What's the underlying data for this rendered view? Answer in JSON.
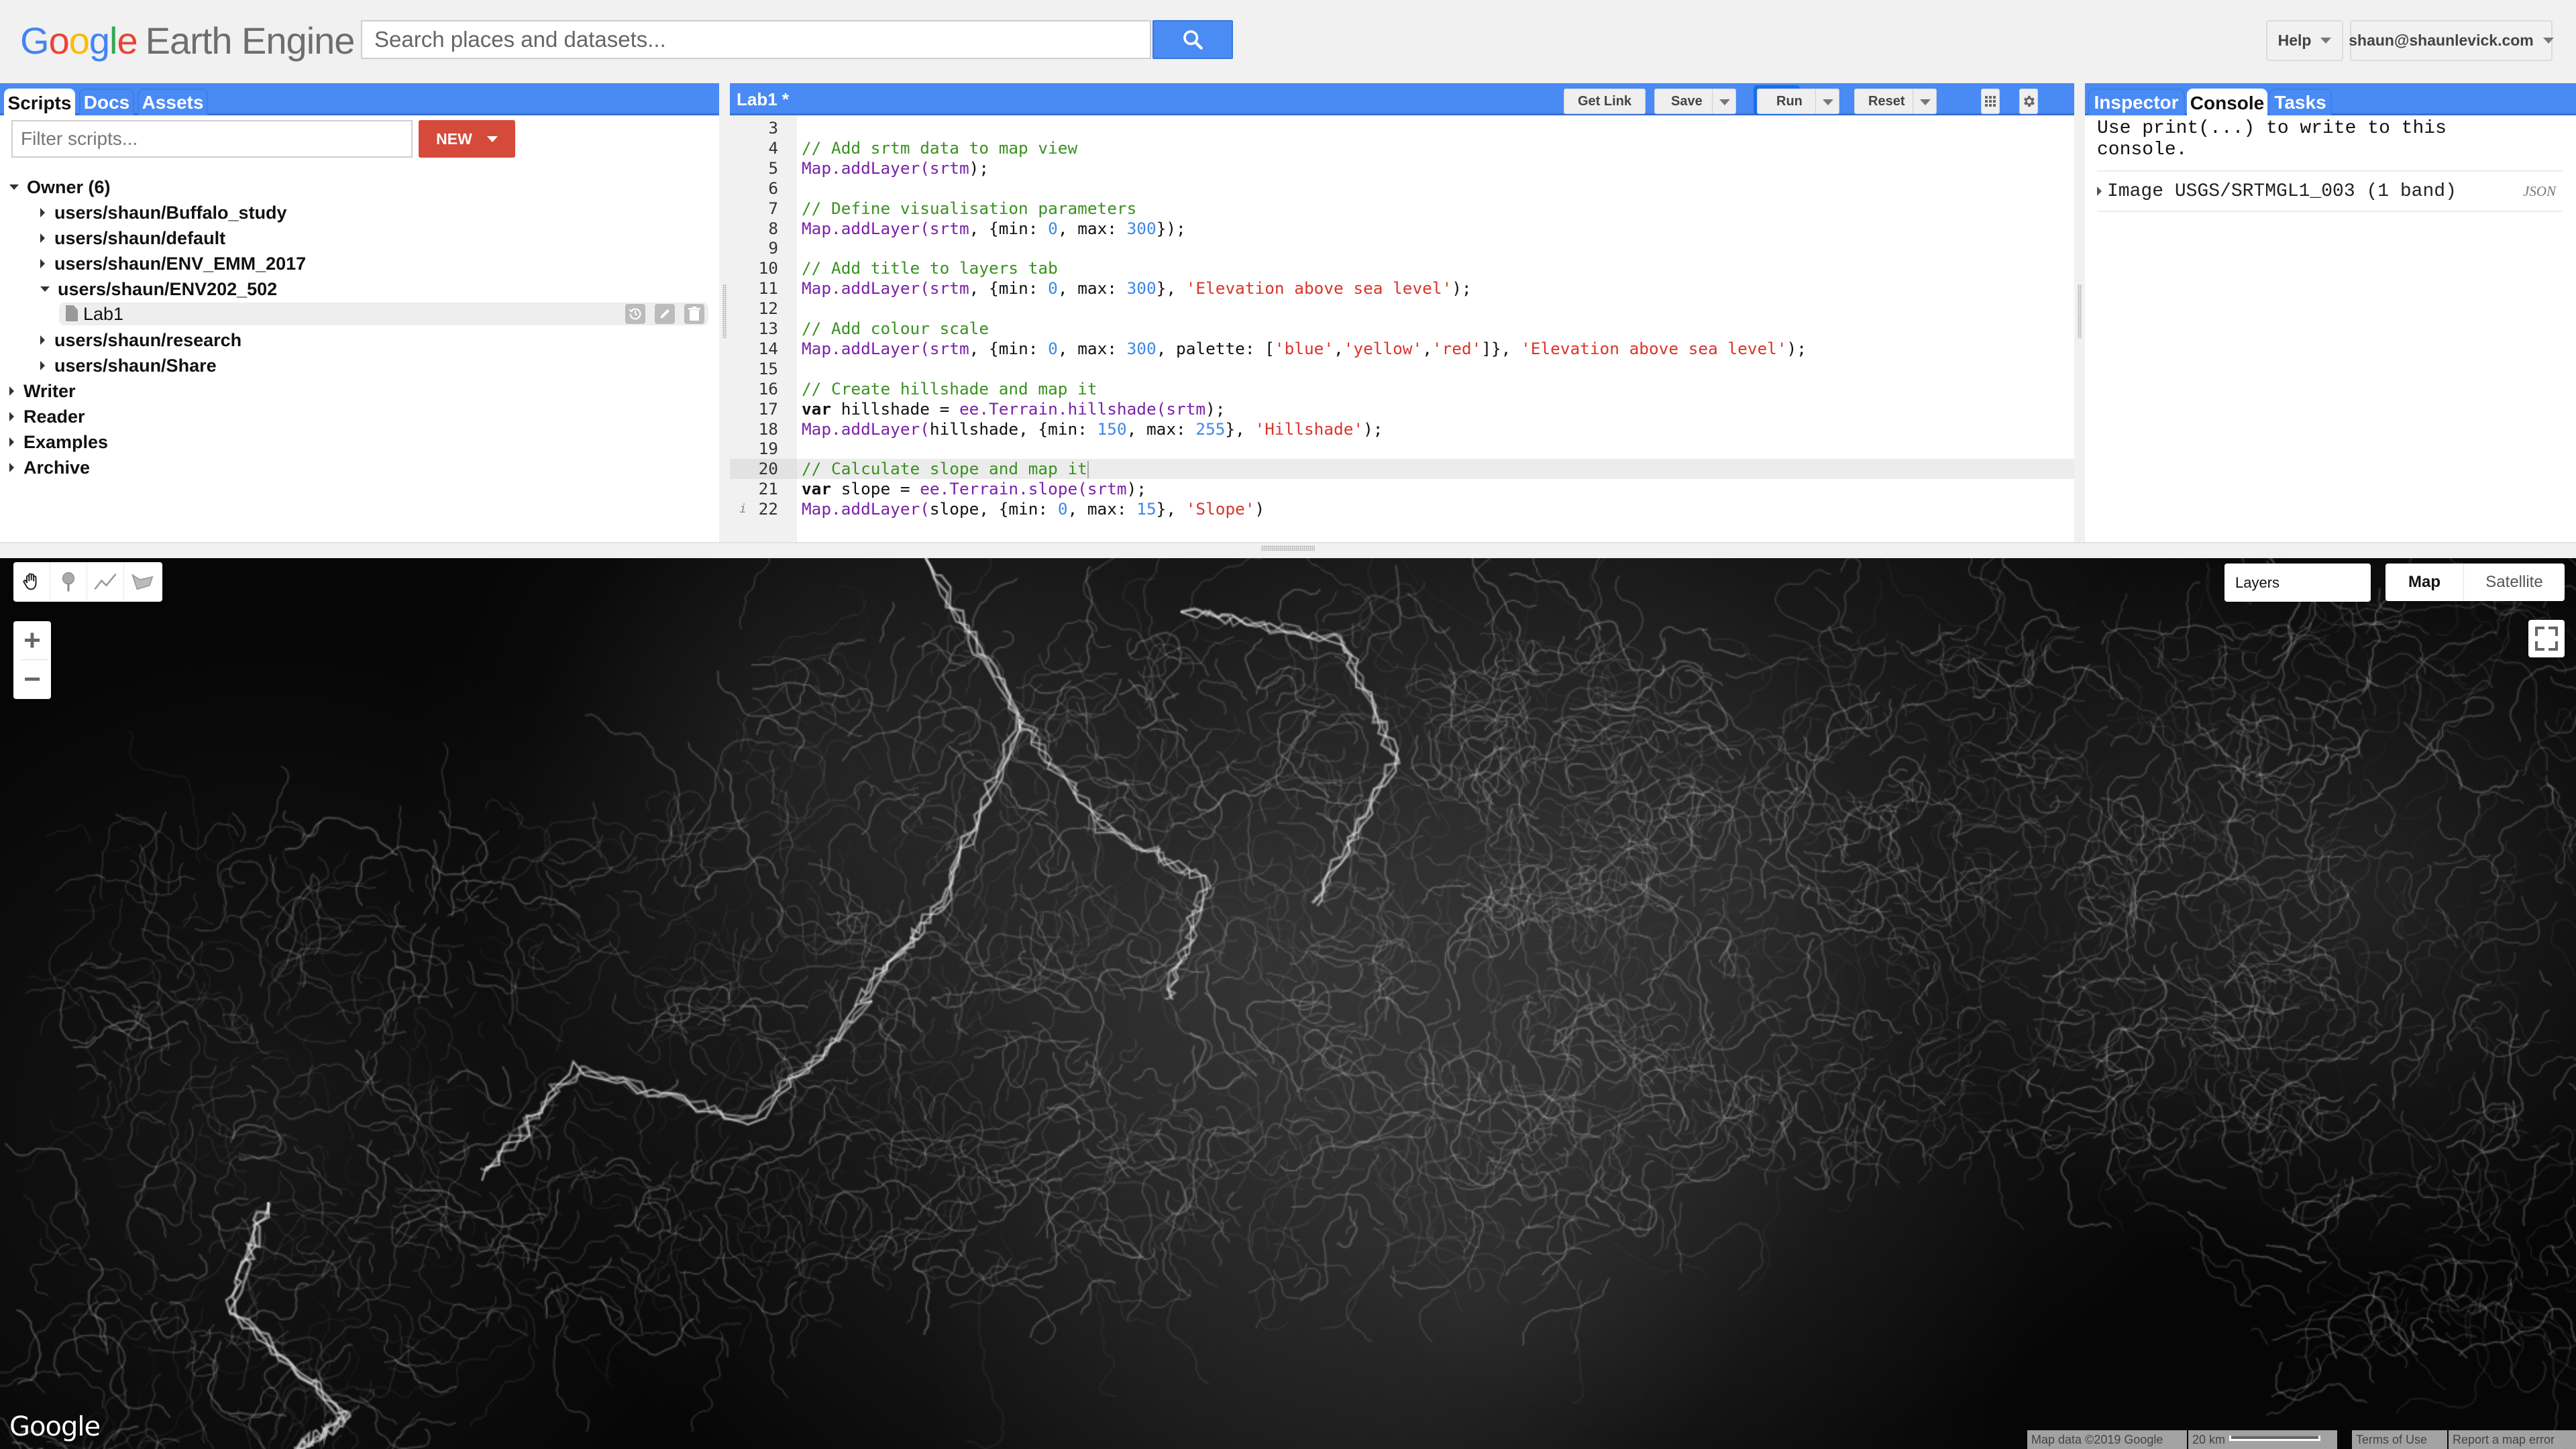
{
  "app": {
    "logo_google": [
      "G",
      "o",
      "o",
      "g",
      "l",
      "e"
    ],
    "logo_google_colors": [
      "#4285f4",
      "#ea4335",
      "#fbbc05",
      "#4285f4",
      "#34a853",
      "#ea4335"
    ],
    "logo_product": "Earth Engine"
  },
  "search": {
    "placeholder": "Search places and datasets..."
  },
  "header": {
    "help_label": "Help",
    "user_label": "shaun@shaunlevick.com"
  },
  "left_panel": {
    "tabs": [
      "Scripts",
      "Docs",
      "Assets"
    ],
    "active_tab": "Scripts",
    "filter_placeholder": "Filter scripts...",
    "new_button": "NEW",
    "tree": [
      {
        "label": "Owner (6)",
        "level": 0,
        "expanded": true
      },
      {
        "label": "users/shaun/Buffalo_study",
        "level": 1,
        "expanded": false
      },
      {
        "label": "users/shaun/default",
        "level": 1,
        "expanded": false
      },
      {
        "label": "users/shaun/ENV_EMM_2017",
        "level": 1,
        "expanded": false
      },
      {
        "label": "users/shaun/ENV202_502",
        "level": 1,
        "expanded": true
      },
      {
        "label": "Lab1",
        "level": 2,
        "type": "file",
        "selected": true
      },
      {
        "label": "users/shaun/research",
        "level": 1,
        "expanded": false
      },
      {
        "label": "users/shaun/Share",
        "level": 1,
        "expanded": false
      },
      {
        "label": "Writer",
        "level": 0,
        "expanded": false
      },
      {
        "label": "Reader",
        "level": 0,
        "expanded": false
      },
      {
        "label": "Examples",
        "level": 0,
        "expanded": false
      },
      {
        "label": "Archive",
        "level": 0,
        "expanded": false
      }
    ]
  },
  "editor": {
    "title": "Lab1 *",
    "buttons": {
      "get_link": "Get Link",
      "save": "Save",
      "run": "Run",
      "reset": "Reset"
    },
    "current_line": 20,
    "lines": [
      {
        "n": 3,
        "tokens": []
      },
      {
        "n": 4,
        "tokens": [
          [
            "cm",
            "// Add srtm data to map view"
          ]
        ]
      },
      {
        "n": 5,
        "tokens": [
          [
            "fn",
            "Map.addLayer("
          ],
          [
            "fn",
            "srtm"
          ],
          [
            "tx",
            ");"
          ]
        ]
      },
      {
        "n": 6,
        "tokens": []
      },
      {
        "n": 7,
        "tokens": [
          [
            "cm",
            "// Define visualisation parameters"
          ]
        ]
      },
      {
        "n": 8,
        "tokens": [
          [
            "fn",
            "Map.addLayer("
          ],
          [
            "fn",
            "srtm"
          ],
          [
            "tx",
            ", {min: "
          ],
          [
            "num",
            "0"
          ],
          [
            "tx",
            ", max: "
          ],
          [
            "num",
            "300"
          ],
          [
            "tx",
            "});"
          ]
        ]
      },
      {
        "n": 9,
        "tokens": []
      },
      {
        "n": 10,
        "tokens": [
          [
            "cm",
            "// Add title to layers tab"
          ]
        ]
      },
      {
        "n": 11,
        "tokens": [
          [
            "fn",
            "Map.addLayer("
          ],
          [
            "fn",
            "srtm"
          ],
          [
            "tx",
            ", {min: "
          ],
          [
            "num",
            "0"
          ],
          [
            "tx",
            ", max: "
          ],
          [
            "num",
            "300"
          ],
          [
            "tx",
            "}, "
          ],
          [
            "str",
            "'Elevation above sea level'"
          ],
          [
            "tx",
            ");"
          ]
        ]
      },
      {
        "n": 12,
        "tokens": []
      },
      {
        "n": 13,
        "tokens": [
          [
            "cm",
            "// Add colour scale"
          ]
        ]
      },
      {
        "n": 14,
        "tokens": [
          [
            "fn",
            "Map.addLayer("
          ],
          [
            "fn",
            "srtm"
          ],
          [
            "tx",
            ", {min: "
          ],
          [
            "num",
            "0"
          ],
          [
            "tx",
            ", max: "
          ],
          [
            "num",
            "300"
          ],
          [
            "tx",
            ", palette: ["
          ],
          [
            "str",
            "'blue'"
          ],
          [
            "tx",
            ","
          ],
          [
            "str",
            "'yellow'"
          ],
          [
            "tx",
            ","
          ],
          [
            "str",
            "'red'"
          ],
          [
            "tx",
            "]}, "
          ],
          [
            "str",
            "'Elevation above sea level'"
          ],
          [
            "tx",
            ");"
          ]
        ]
      },
      {
        "n": 15,
        "tokens": []
      },
      {
        "n": 16,
        "tokens": [
          [
            "cm",
            "// Create hillshade and map it"
          ]
        ]
      },
      {
        "n": 17,
        "tokens": [
          [
            "kw",
            "var"
          ],
          [
            "tx",
            " hillshade = "
          ],
          [
            "fn",
            "ee.Terrain.hillshade("
          ],
          [
            "fn",
            "srtm"
          ],
          [
            "tx",
            ");"
          ]
        ]
      },
      {
        "n": 18,
        "tokens": [
          [
            "fn",
            "Map.addLayer("
          ],
          [
            "tx",
            "hillshade, {min: "
          ],
          [
            "num",
            "150"
          ],
          [
            "tx",
            ", max: "
          ],
          [
            "num",
            "255"
          ],
          [
            "tx",
            "}, "
          ],
          [
            "str",
            "'Hillshade'"
          ],
          [
            "tx",
            ");"
          ]
        ]
      },
      {
        "n": 19,
        "tokens": []
      },
      {
        "n": 20,
        "tokens": [
          [
            "cm",
            "// Calculate slope and map it"
          ]
        ]
      },
      {
        "n": 21,
        "tokens": [
          [
            "kw",
            "var"
          ],
          [
            "tx",
            " slope = "
          ],
          [
            "fn",
            "ee.Terrain.slope("
          ],
          [
            "fn",
            "srtm"
          ],
          [
            "tx",
            ");"
          ]
        ]
      },
      {
        "n": 22,
        "tokens": [
          [
            "fn",
            "Map.addLayer("
          ],
          [
            "tx",
            "slope, {min: "
          ],
          [
            "num",
            "0"
          ],
          [
            "tx",
            ", max: "
          ],
          [
            "num",
            "15"
          ],
          [
            "tx",
            "}, "
          ],
          [
            "str",
            "'Slope'"
          ],
          [
            "tx",
            ")"
          ]
        ],
        "info": "i"
      }
    ]
  },
  "right_panel": {
    "tabs": [
      "Inspector",
      "Console",
      "Tasks"
    ],
    "active_tab": "Console",
    "console_hint": "Use print(...) to write to this console.",
    "console_items": [
      {
        "label": "Image USGS/SRTMGL1_003 (1 band)",
        "tag": "JSON"
      }
    ]
  },
  "map": {
    "layers_label": "Layers",
    "map_types": [
      "Map",
      "Satellite"
    ],
    "active_map_type": "Map",
    "zoom_in": "+",
    "zoom_out": "−",
    "watermark": "Google",
    "attribution": "Map data ©2019 Google",
    "scale_label": "20 km",
    "terms": "Terms of Use",
    "report": "Report a map error",
    "tools": [
      "pan-hand",
      "point-marker",
      "line",
      "polygon"
    ]
  }
}
